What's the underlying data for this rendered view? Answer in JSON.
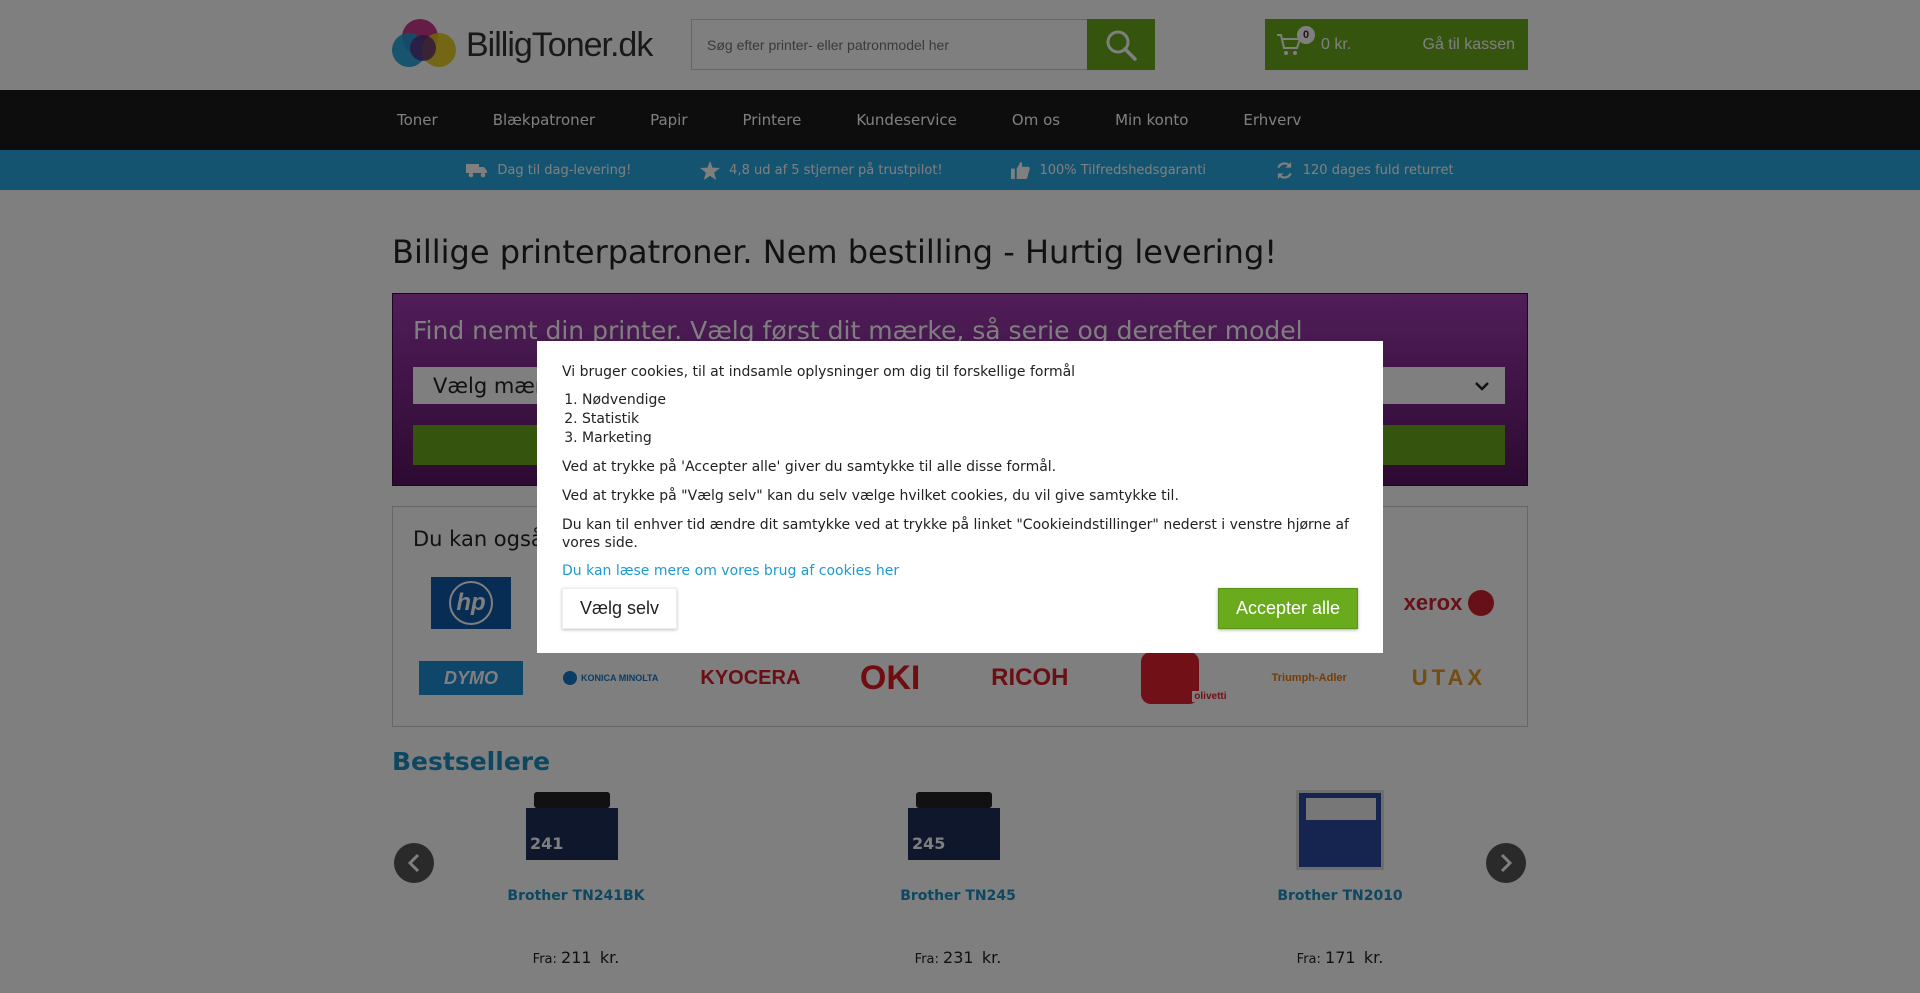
{
  "header": {
    "logo_text": "BilligToner.dk",
    "search_placeholder": "Søg efter printer- eller patronmodel her",
    "cart_count": "0",
    "cart_amount": "0 kr.",
    "checkout_label": "Gå til kassen"
  },
  "nav": {
    "items": [
      "Toner",
      "Blækpatroner",
      "Papir",
      "Printere",
      "Kundeservice",
      "Om os",
      "Min konto",
      "Erhverv"
    ]
  },
  "usp": {
    "items": [
      {
        "icon": "truck-icon",
        "text": "Dag til dag-levering!"
      },
      {
        "icon": "star-icon",
        "text": "4,8 ud af 5 stjerner på trustpilot!"
      },
      {
        "icon": "thumbs-up-icon",
        "text": "100% Tilfredshedsgaranti"
      },
      {
        "icon": "refresh-icon",
        "text": "120 dages fuld returret"
      }
    ]
  },
  "main": {
    "title": "Billige printerpatroner. Nem bestilling - Hurtig levering!",
    "finder": {
      "title": "Find nemt din printer. Vælg først dit mærke, så serie og derefter model",
      "select_value": "Vælg mærke"
    },
    "brands": {
      "title": "Du kan også",
      "row1": [
        "hp",
        "xerox"
      ],
      "row2": [
        "DYMO",
        "KONICA MINOLTA",
        "KYOCERA",
        "OKI",
        "RICOH",
        "olivetti",
        "Triumph-Adler",
        "UTAX"
      ]
    },
    "bestsellers": {
      "title": "Bestsellere",
      "products": [
        {
          "name": "Brother TN241BK",
          "price_prefix": "Fra:",
          "price": "211",
          "currency": "kr.",
          "box_label": "241",
          "box_color": "#1e2f5a"
        },
        {
          "name": "Brother TN245",
          "price_prefix": "Fra:",
          "price": "231",
          "currency": "kr.",
          "box_label": "245",
          "box_color": "#1e2f5a"
        },
        {
          "name": "Brother TN2010",
          "price_prefix": "Fra:",
          "price": "171",
          "currency": "kr.",
          "box_label": "",
          "box_color": "#2a4aa0"
        }
      ]
    }
  },
  "cookie": {
    "intro": "Vi bruger cookies, til at indsamle oplysninger om dig til forskellige formål",
    "purposes": [
      "Nødvendige",
      "Statistik",
      "Marketing"
    ],
    "accept_all_text": "Ved at trykke på 'Accepter alle' giver du samtykke til alle disse formål.",
    "choose_text": "Ved at trykke på \"Vælg selv\" kan du selv vælge hvilket cookies, du vil give samtykke til.",
    "change_text": "Du kan til enhver tid ændre dit samtykke ved at trykke på linket \"Cookieindstillinger\" nederst i venstre hjørne af vores side.",
    "read_more_link": "Du kan læse mere om vores brug af cookies her",
    "choose_button": "Vælg selv",
    "accept_button": "Accepter alle"
  },
  "colors": {
    "accent_green": "#6aaa1d",
    "usp_blue": "#29a8e0",
    "link_blue": "#1d8fc2",
    "nav_black": "#1a1a1a",
    "finder_purple": "#a13bb3"
  }
}
